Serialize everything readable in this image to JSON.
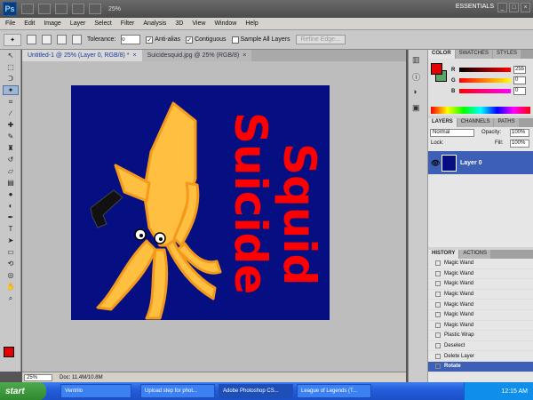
{
  "app": {
    "logo": "Ps",
    "zoom_label": "25%",
    "workspace": "ESSENTIALS"
  },
  "menu": [
    "File",
    "Edit",
    "Image",
    "Layer",
    "Select",
    "Filter",
    "Analysis",
    "3D",
    "View",
    "Window",
    "Help"
  ],
  "options": {
    "tolerance_label": "Tolerance:",
    "tolerance_value": "0",
    "anti_alias": "Anti-alias",
    "contiguous": "Contiguous",
    "sample_all": "Sample All Layers",
    "refine": "Refine Edge..."
  },
  "tabs": [
    {
      "label": "Untitled-1 @ 25% (Layer 0, RGB/8) *"
    },
    {
      "label": "Suicidesquid.jpg @ 25% (RGB/8)"
    }
  ],
  "artwork": {
    "word1": "Suicide",
    "word2": "Squid",
    "bg_color": "#050f82",
    "squid_color": "#ffbf40"
  },
  "status": {
    "zoom": "25%",
    "doc": "Doc: 11.4M/10.8M"
  },
  "color_panel": {
    "tabs": [
      "COLOR",
      "SWATCHES",
      "STYLES"
    ],
    "r": "255",
    "g": "0",
    "b": "0"
  },
  "layers_panel": {
    "tabs": [
      "LAYERS",
      "CHANNELS",
      "PATHS"
    ],
    "blend": "Normal",
    "opacity_label": "Opacity:",
    "opacity": "100%",
    "lock_label": "Lock:",
    "fill_label": "Fill:",
    "fill": "100%",
    "layer_name": "Layer 0"
  },
  "history_panel": {
    "tabs": [
      "HISTORY",
      "ACTIONS"
    ],
    "items": [
      "Magic Wand",
      "Magic Wand",
      "Magic Wand",
      "Magic Wand",
      "Magic Wand",
      "Magic Wand",
      "Magic Wand",
      "Plastic Wrap",
      "Deselect",
      "Delete Layer",
      "Rotate"
    ]
  },
  "taskbar": {
    "start": "start",
    "tasks": [
      "Ventrilo",
      "Upload step for phot...",
      "Adobe Photoshop CS...",
      "League of Legends (T..."
    ],
    "clock": "12:15 AM"
  }
}
